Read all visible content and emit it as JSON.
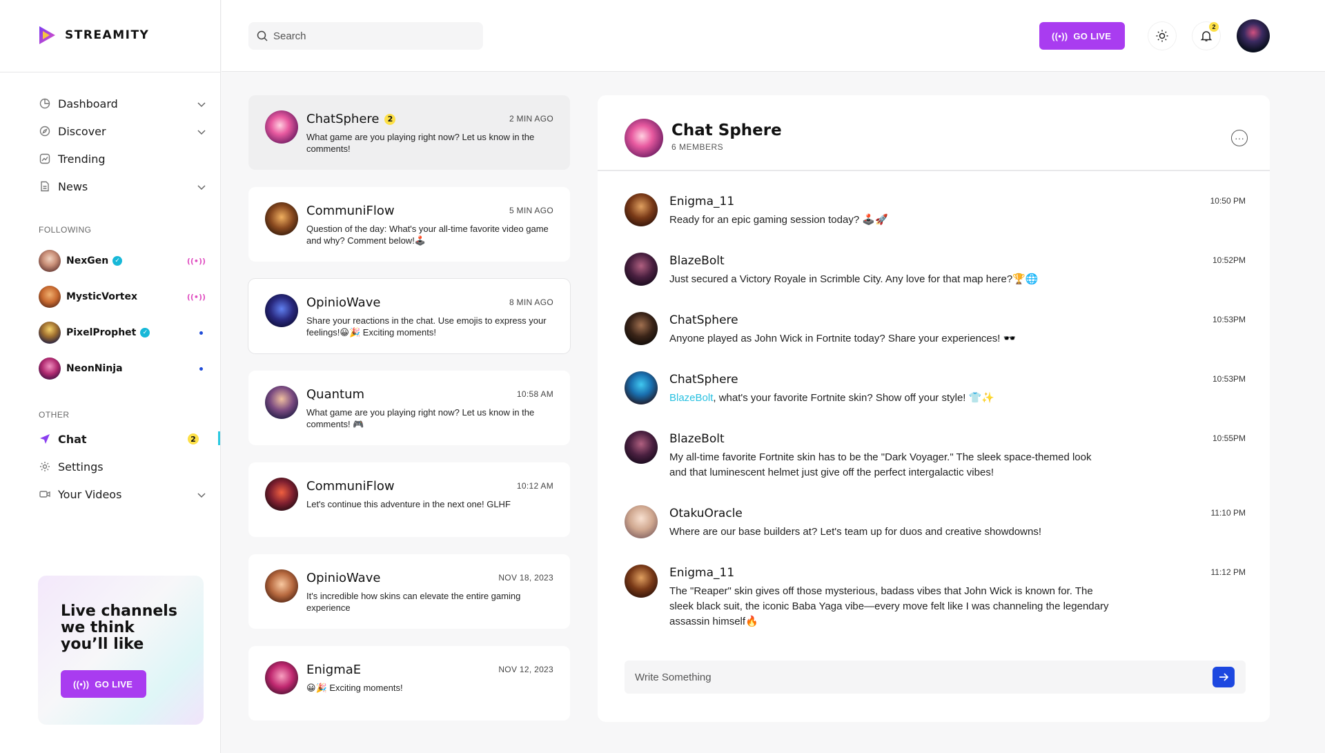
{
  "brand": {
    "name": "STREAMITY"
  },
  "search": {
    "placeholder": "Search"
  },
  "header": {
    "go_live_label": "GO LIVE",
    "notifications_count": "2"
  },
  "nav": {
    "items": [
      {
        "label": "Dashboard",
        "icon": "dashboard-icon",
        "has_dropdown": true
      },
      {
        "label": "Discover",
        "icon": "compass-icon",
        "has_dropdown": true
      },
      {
        "label": "Trending",
        "icon": "trending-icon",
        "has_dropdown": false
      },
      {
        "label": "News",
        "icon": "news-icon",
        "has_dropdown": true
      }
    ]
  },
  "following": {
    "label": "FOLLOWING",
    "users": [
      {
        "name": "NexGen",
        "verified": true,
        "status": "live"
      },
      {
        "name": "MysticVortex",
        "verified": false,
        "status": "live"
      },
      {
        "name": "PixelProphet",
        "verified": true,
        "status": "online"
      },
      {
        "name": "NeonNinja",
        "verified": false,
        "status": "online"
      }
    ]
  },
  "other": {
    "label": "OTHER",
    "items": [
      {
        "label": "Chat",
        "icon": "send-icon",
        "badge": "2",
        "active": true
      },
      {
        "label": "Settings",
        "icon": "gear-icon"
      },
      {
        "label": "Your Videos",
        "icon": "video-icon",
        "has_dropdown": true
      }
    ]
  },
  "promo": {
    "title": "Live channels we think you’ll like",
    "button_label": "GO LIVE"
  },
  "conversations": [
    {
      "name": "ChatSphere",
      "badge": "2",
      "time": "2 MIN AGO",
      "message": "What game are you playing right now? Let us know in the comments!"
    },
    {
      "name": "CommuniFlow",
      "time": "5 MIN AGO",
      "message": "Question of the day: What's your all-time favorite video game and why? Comment below!🕹️"
    },
    {
      "name": "OpinioWave",
      "time": "8 MIN AGO",
      "message": "Share your reactions in the chat. Use emojis to express your feelings!😀🎉 Exciting moments!"
    },
    {
      "name": "Quantum",
      "time": "10:58 AM",
      "message": "What game are you playing right now? Let us know in the comments! 🎮"
    },
    {
      "name": "CommuniFlow",
      "time": "10:12 AM",
      "message": "Let's continue this adventure in the next one! GLHF"
    },
    {
      "name": "OpinioWave",
      "time": "NOV 18, 2023",
      "message": "It's incredible how skins can elevate the entire gaming experience"
    },
    {
      "name": "EnigmaE",
      "time": "NOV 12, 2023",
      "message": "😀🎉 Exciting moments!"
    }
  ],
  "chat": {
    "title": "Chat Sphere",
    "members": "6 MEMBERS",
    "messages": [
      {
        "name": "Enigma_11",
        "time": "10:50 PM",
        "text": "Ready for an epic gaming session today? 🕹️🚀"
      },
      {
        "name": "BlazeBolt",
        "time": "10:52PM",
        "text": "Just secured a Victory Royale in Scrimble City. Any love for that map here?🏆🌐"
      },
      {
        "name": "ChatSphere",
        "time": "10:53PM",
        "text": "Anyone played as John Wick in Fortnite today? Share your experiences! 🕶️"
      },
      {
        "name": "ChatSphere",
        "time": "10:53PM",
        "mention": "BlazeBolt",
        "text": ", what's your favorite Fortnite skin? Show off your style! 👕✨"
      },
      {
        "name": "BlazeBolt",
        "time": "10:55PM",
        "text": "My all-time favorite Fortnite skin has to be the \"Dark Voyager.\" The sleek space-themed look and that luminescent helmet just give off the perfect intergalactic vibes!"
      },
      {
        "name": "OtakuOracle",
        "time": "11:10 PM",
        "text": "Where are our base builders at? Let's team up for duos and creative showdowns!"
      },
      {
        "name": "Enigma_11",
        "time": "11:12 PM",
        "text": "The \"Reaper\" skin gives off those mysterious, badass vibes that John Wick is known for. The sleek black suit, the iconic Baba Yaga vibe—every move felt like I was channeling the legendary assassin himself🔥"
      }
    ],
    "composer_placeholder": "Write Something"
  },
  "colors": {
    "accent": "#a93cf0",
    "mention": "#27c0e0",
    "send": "#1d48e0",
    "badge": "#fde047"
  }
}
